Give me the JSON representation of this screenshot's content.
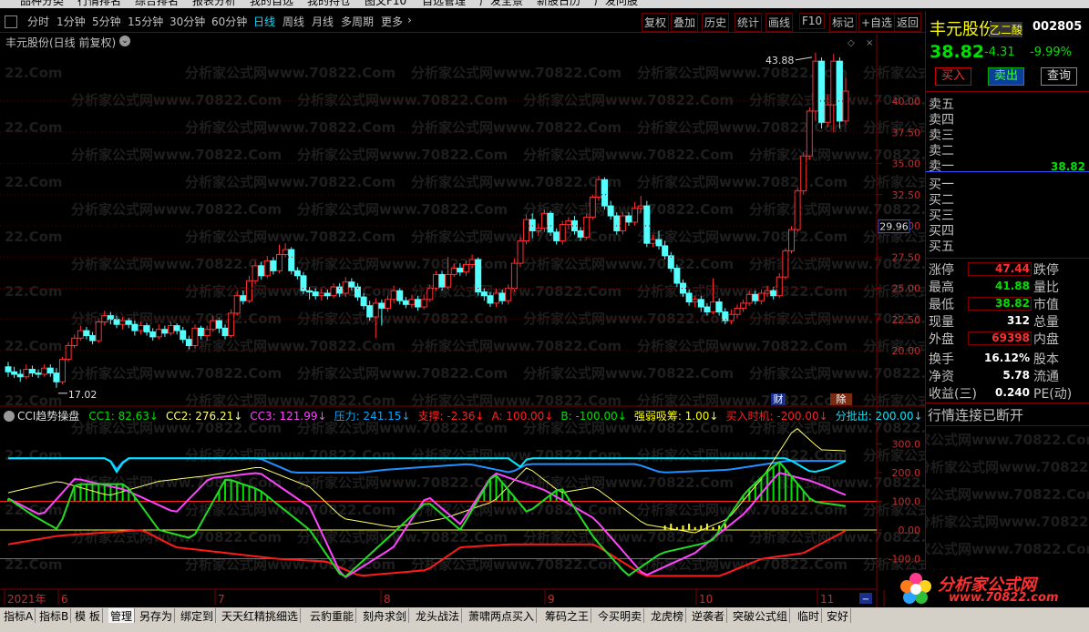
{
  "menu": [
    "品种分类",
    "行情排名",
    "综合排名",
    "报表分析",
    "我的自选",
    "我的持仓",
    "图文F10",
    "自选管理",
    "广发全景",
    "新股日历",
    "广发问股"
  ],
  "toolbar": {
    "periods": [
      "分时",
      "1分钟",
      "5分钟",
      "15分钟",
      "30分钟",
      "60分钟",
      "日线",
      "周线",
      "月线",
      "多周期",
      "更多"
    ],
    "active": "日线",
    "actions": [
      "复权",
      "叠加",
      "历史",
      "统计",
      "画线",
      "F10",
      "标记",
      "+自选",
      "返回"
    ]
  },
  "stock": {
    "name": "丰元股份",
    "code": "002805",
    "price": "38.82",
    "change": "-4.31",
    "change_pct": "-9.99%",
    "tag": "乙二酸",
    "buy": "买入",
    "sell": "卖出",
    "query": "查询"
  },
  "chart_title": "丰元股份(日线 前复权)",
  "orderbook": {
    "sell": [
      "卖五",
      "卖四",
      "卖三",
      "卖二",
      "卖一"
    ],
    "buy": [
      "买一",
      "买二",
      "买三",
      "买四",
      "买五"
    ],
    "sell1_price": "38.82"
  },
  "stats": {
    "zt_label": "涨停",
    "zt": "47.44",
    "dt_label": "跌停",
    "high_label": "最高",
    "high": "41.88",
    "lb_label": "量比",
    "low_label": "最低",
    "low": "38.82",
    "sz_label": "市值",
    "cur_label": "现量",
    "cur": "312",
    "zl_label": "总量",
    "wp_label": "外盘",
    "wp": "69398",
    "np_label": "内盘",
    "hs_label": "换手",
    "hs": "16.12%",
    "gb_label": "股本",
    "jz_label": "净资",
    "jz": "5.78",
    "lt_label": "流通",
    "sy_label": "收益(三)",
    "sy": "0.240",
    "pe_label": "PE(动)",
    "conn": "行情连接已断开"
  },
  "watermarks": [
    "22.Com",
    "分析家公式网www.70822.Com",
    "分析家公式网www.70822.Com",
    "分析家公式网www.70822.Com",
    "分析家公式网www.70822.Com"
  ],
  "brand": {
    "name": "分析家公式网",
    "url": "www.70822.com"
  },
  "markers": {
    "fin": "财",
    "ex": "除"
  },
  "indicator": {
    "name": "CCI趋势操盘",
    "labels": [
      {
        "t": "CC1: 82.63",
        "c": "#00e000"
      },
      {
        "t": "CC2: 276.21",
        "c": "#ffff66"
      },
      {
        "t": "CC3: 121.99",
        "c": "#ff44ff"
      },
      {
        "t": "压力: 241.15",
        "c": "#00aaff"
      },
      {
        "t": "支撑: -2.36",
        "c": "#ff2020"
      },
      {
        "t": "A: 100.00",
        "c": "#ff2020"
      },
      {
        "t": "B: -100.00",
        "c": "#00e000"
      },
      {
        "t": "强弱吸筹: 1.00",
        "c": "#ffff00"
      },
      {
        "t": "买入时机: -200.00",
        "c": "#ff2020"
      },
      {
        "t": "分批出: 200.00",
        "c": "#00e8ff"
      }
    ]
  },
  "bottom_tabs": [
    "指标A",
    "指标B",
    "模 板",
    "管理",
    "另存为",
    "绑定到",
    "天天红精挑细选",
    "云豹重能",
    "刻舟求剑",
    "龙头战法",
    "萧啸两点买入",
    "筹码之王",
    "今买明卖",
    "龙虎榜",
    "逆袭者",
    "突破公式组",
    "临时",
    "安好"
  ],
  "chart_data": {
    "type": "candlestick",
    "yaxis": [
      40.0,
      37.5,
      35.0,
      32.5,
      30.0,
      27.5,
      25.0,
      22.5,
      20.0
    ],
    "ylim": [
      16.5,
      45.5
    ],
    "current_price_tag": "29.96",
    "high_marker": "43.88",
    "low_marker": "17.02",
    "x_labels": [
      "2021年",
      "6",
      "7",
      "8",
      "9",
      "10",
      "11"
    ],
    "candles": [
      [
        18.7,
        18.3,
        17.9,
        19.1
      ],
      [
        18.3,
        18.1,
        17.8,
        18.7
      ],
      [
        18.1,
        17.9,
        17.5,
        18.5
      ],
      [
        17.9,
        18.5,
        17.7,
        18.9
      ],
      [
        18.5,
        18.2,
        17.9,
        18.8
      ],
      [
        18.2,
        18.1,
        17.8,
        18.5
      ],
      [
        18.1,
        18.6,
        17.9,
        18.9
      ],
      [
        18.6,
        18.2,
        17.9,
        18.9
      ],
      [
        18.2,
        17.5,
        17.02,
        18.6
      ],
      [
        17.5,
        19.3,
        17.3,
        19.5
      ],
      [
        19.3,
        20.4,
        19.1,
        20.7
      ],
      [
        20.4,
        21.0,
        20.2,
        21.3
      ],
      [
        21.0,
        21.6,
        20.8,
        22.0
      ],
      [
        21.6,
        21.2,
        20.9,
        21.9
      ],
      [
        21.2,
        20.8,
        20.5,
        21.5
      ],
      [
        20.8,
        22.3,
        20.6,
        22.6
      ],
      [
        22.3,
        22.8,
        22.0,
        23.2
      ],
      [
        22.8,
        22.5,
        22.1,
        23.1
      ],
      [
        22.5,
        22.1,
        21.8,
        22.8
      ],
      [
        22.1,
        22.4,
        21.7,
        22.7
      ],
      [
        22.4,
        22.1,
        21.8,
        22.6
      ],
      [
        22.1,
        21.6,
        21.2,
        22.4
      ],
      [
        21.6,
        22.0,
        21.3,
        22.3
      ],
      [
        22.0,
        21.5,
        21.2,
        22.2
      ],
      [
        21.5,
        21.1,
        20.8,
        21.8
      ],
      [
        21.1,
        21.7,
        20.9,
        22.1
      ],
      [
        21.7,
        21.4,
        21.1,
        22.0
      ],
      [
        21.4,
        22.0,
        21.2,
        22.3
      ],
      [
        22.0,
        21.6,
        21.3,
        22.2
      ],
      [
        21.6,
        20.9,
        20.6,
        21.9
      ],
      [
        20.9,
        20.4,
        20.1,
        21.2
      ],
      [
        20.4,
        21.8,
        20.2,
        22.1
      ],
      [
        21.8,
        21.2,
        20.9,
        22.0
      ],
      [
        21.2,
        21.7,
        20.8,
        22.0
      ],
      [
        21.7,
        22.4,
        21.5,
        22.8
      ],
      [
        22.4,
        21.8,
        21.4,
        22.6
      ],
      [
        21.8,
        21.2,
        20.9,
        22.1
      ],
      [
        21.2,
        23.0,
        21.0,
        23.3
      ],
      [
        23.0,
        24.4,
        22.8,
        24.8
      ],
      [
        24.4,
        24.0,
        23.7,
        24.8
      ],
      [
        24.0,
        25.6,
        23.8,
        26.0
      ],
      [
        25.6,
        26.8,
        25.3,
        27.2
      ],
      [
        26.8,
        26.0,
        25.7,
        27.1
      ],
      [
        26.0,
        27.2,
        25.8,
        27.6
      ],
      [
        27.2,
        26.4,
        26.1,
        27.5
      ],
      [
        26.4,
        27.7,
        26.2,
        28.5
      ],
      [
        27.7,
        28.1,
        27.5,
        28.6
      ],
      [
        28.1,
        26.4,
        26.1,
        28.3
      ],
      [
        26.4,
        26.0,
        25.7,
        26.7
      ],
      [
        26.0,
        24.8,
        24.5,
        26.3
      ],
      [
        24.8,
        24.7,
        24.1,
        25.1
      ],
      [
        24.7,
        24.4,
        24.1,
        25.0
      ],
      [
        24.4,
        24.6,
        24.0,
        25.0
      ],
      [
        24.6,
        24.4,
        24.1,
        24.9
      ],
      [
        24.4,
        25.1,
        24.2,
        25.4
      ],
      [
        25.1,
        24.6,
        24.3,
        25.4
      ],
      [
        24.6,
        25.5,
        24.3,
        25.9
      ],
      [
        25.5,
        25.1,
        24.8,
        25.8
      ],
      [
        25.1,
        24.3,
        24.0,
        25.4
      ],
      [
        24.3,
        23.6,
        23.3,
        24.6
      ],
      [
        23.6,
        22.7,
        22.4,
        24.0
      ],
      [
        22.7,
        23.8,
        21.0,
        24.2
      ],
      [
        23.8,
        23.4,
        22.0,
        24.1
      ],
      [
        23.4,
        24.1,
        23.1,
        24.4
      ],
      [
        24.1,
        24.8,
        23.8,
        25.2
      ],
      [
        24.8,
        24.0,
        23.7,
        25.0
      ],
      [
        24.0,
        23.7,
        23.4,
        24.3
      ],
      [
        23.7,
        24.1,
        23.4,
        24.5
      ],
      [
        24.1,
        23.5,
        23.2,
        24.4
      ],
      [
        23.5,
        24.1,
        23.3,
        24.5
      ],
      [
        24.1,
        25.0,
        23.9,
        25.3
      ],
      [
        25.0,
        26.1,
        24.8,
        26.4
      ],
      [
        26.1,
        25.1,
        24.8,
        26.4
      ],
      [
        25.1,
        26.1,
        24.9,
        27.5
      ],
      [
        26.1,
        26.6,
        25.9,
        27.0
      ],
      [
        26.6,
        26.3,
        26.0,
        27.0
      ],
      [
        26.3,
        26.9,
        26.0,
        27.2
      ],
      [
        26.9,
        27.3,
        26.6,
        27.7
      ],
      [
        27.3,
        24.7,
        24.4,
        27.5
      ],
      [
        24.7,
        24.4,
        24.0,
        25.0
      ],
      [
        24.4,
        23.8,
        23.5,
        24.7
      ],
      [
        23.8,
        24.6,
        23.5,
        25.0
      ],
      [
        24.6,
        24.0,
        23.7,
        24.9
      ],
      [
        24.0,
        25.0,
        23.7,
        25.3
      ],
      [
        25.0,
        27.0,
        24.7,
        27.4
      ],
      [
        27.0,
        28.8,
        26.7,
        29.1
      ],
      [
        28.8,
        30.5,
        28.5,
        30.9
      ],
      [
        30.5,
        29.6,
        29.0,
        31.0
      ],
      [
        29.6,
        29.8,
        29.2,
        30.2
      ],
      [
        29.8,
        31.0,
        29.5,
        31.3
      ],
      [
        31.0,
        29.5,
        29.2,
        31.2
      ],
      [
        29.5,
        28.8,
        28.5,
        29.8
      ],
      [
        28.8,
        30.1,
        28.5,
        30.4
      ],
      [
        30.1,
        30.4,
        29.7,
        30.7
      ],
      [
        30.4,
        29.6,
        29.3,
        30.8
      ],
      [
        29.6,
        29.1,
        28.8,
        29.9
      ],
      [
        29.1,
        30.7,
        28.9,
        31.0
      ],
      [
        30.7,
        32.3,
        30.5,
        32.5
      ],
      [
        32.3,
        33.7,
        32.0,
        34.0
      ],
      [
        33.7,
        31.6,
        31.3,
        33.9
      ],
      [
        31.6,
        30.8,
        30.5,
        32.0
      ],
      [
        30.8,
        29.6,
        29.3,
        31.1
      ],
      [
        29.6,
        30.8,
        29.3,
        31.1
      ],
      [
        30.8,
        30.3,
        30.0,
        31.1
      ],
      [
        30.3,
        31.4,
        30.0,
        31.9
      ],
      [
        31.4,
        31.6,
        31.0,
        32.4
      ],
      [
        31.6,
        28.6,
        28.3,
        32.0
      ],
      [
        28.6,
        28.9,
        28.3,
        29.3
      ],
      [
        28.9,
        28.4,
        28.1,
        29.6
      ],
      [
        28.4,
        27.6,
        27.3,
        28.8
      ],
      [
        27.6,
        26.6,
        26.3,
        27.9
      ],
      [
        26.6,
        25.4,
        25.1,
        26.9
      ],
      [
        25.4,
        24.6,
        24.3,
        25.7
      ],
      [
        24.6,
        23.9,
        23.6,
        24.9
      ],
      [
        23.9,
        24.1,
        23.5,
        24.4
      ],
      [
        24.1,
        23.5,
        23.1,
        24.4
      ],
      [
        23.5,
        23.1,
        22.8,
        23.8
      ],
      [
        23.1,
        23.9,
        22.9,
        25.8
      ],
      [
        23.9,
        23.1,
        22.8,
        24.2
      ],
      [
        23.1,
        22.4,
        22.1,
        23.4
      ],
      [
        22.4,
        22.9,
        22.1,
        23.3
      ],
      [
        22.9,
        23.4,
        22.6,
        23.7
      ],
      [
        23.4,
        23.8,
        23.1,
        24.1
      ],
      [
        23.8,
        24.5,
        23.6,
        24.8
      ],
      [
        24.5,
        24.0,
        23.7,
        24.8
      ],
      [
        24.0,
        24.6,
        23.7,
        24.9
      ],
      [
        24.6,
        24.8,
        24.3,
        25.2
      ],
      [
        24.8,
        24.4,
        24.1,
        25.1
      ],
      [
        24.4,
        25.9,
        24.2,
        26.2
      ],
      [
        25.9,
        28.0,
        25.7,
        28.2
      ],
      [
        28.0,
        29.7,
        27.8,
        30.0
      ],
      [
        29.7,
        32.8,
        29.5,
        33.1
      ],
      [
        32.8,
        35.6,
        32.5,
        35.9
      ],
      [
        35.6,
        39.2,
        35.3,
        39.5
      ],
      [
        39.2,
        43.2,
        38.4,
        43.88
      ],
      [
        43.2,
        38.3,
        37.8,
        43.5
      ],
      [
        38.3,
        39.7,
        37.9,
        40.5
      ],
      [
        39.7,
        43.2,
        37.5,
        43.8
      ],
      [
        43.2,
        38.4,
        37.8,
        43.5
      ],
      [
        38.4,
        40.8,
        38.1,
        41.88
      ]
    ],
    "cci_yaxis": [
      "300.0",
      "200.0",
      "100.0",
      "0.00",
      "-100.0"
    ],
    "cci_ylim": [
      -190,
      370
    ]
  }
}
